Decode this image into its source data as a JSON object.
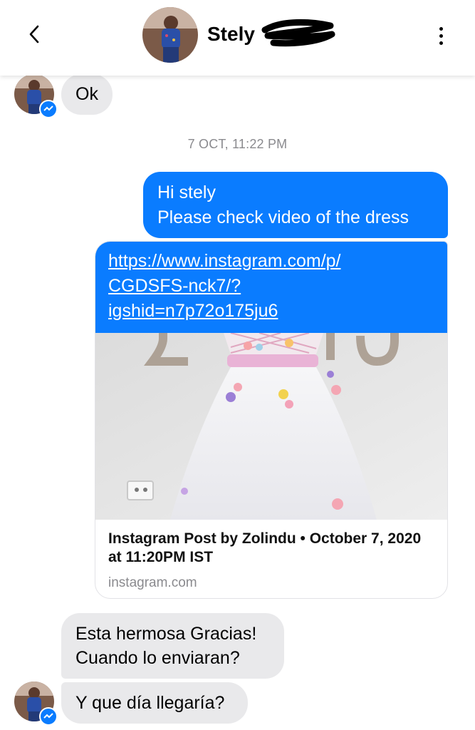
{
  "header": {
    "contact_name": "Stely"
  },
  "conversation": {
    "incoming_ok": "Ok",
    "timestamp": "7 OCT, 11:22 PM",
    "outgoing_line1": "Hi stely",
    "outgoing_line2": "Please check video of the dress",
    "link_url": "https://www.instagram.com/p/CGDSFS-nck7/?igshid=n7p72o175ju6",
    "link_url_lines": [
      "https://www.instagram.com/p/",
      "CGDSFS-nck7/?",
      "igshid=n7p72o175ju6"
    ],
    "preview_title": "Instagram Post by Zolindu • October  7, 2020 at 11:20PM IST",
    "preview_domain": "instagram.com",
    "incoming_reply_line1": "Esta hermosa Gracias!",
    "incoming_reply_line2": "Cuando lo enviaran?",
    "incoming_last": "Y que día llegaría?"
  },
  "colors": {
    "outgoing_bubble": "#0a7cff",
    "incoming_bubble": "#e9e9eb",
    "timestamp_text": "#8a8a8e"
  },
  "icons": [
    "back-chevron-icon",
    "more-vertical-icon",
    "messenger-badge-icon"
  ]
}
